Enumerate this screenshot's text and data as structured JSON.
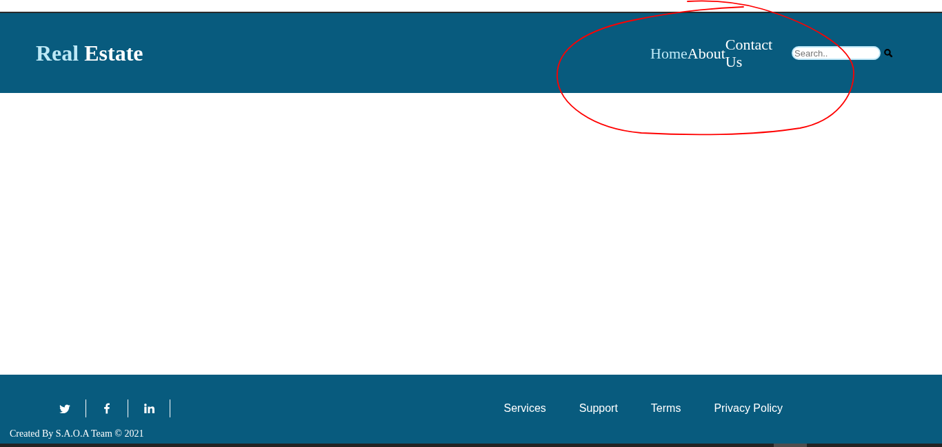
{
  "header": {
    "logo": {
      "words": [
        {
          "text": "Real",
          "accent": true
        },
        {
          "text": "Estate",
          "accent": false
        }
      ]
    },
    "nav": [
      {
        "label": "Home",
        "selected": true
      },
      {
        "label": "About",
        "selected": false
      },
      {
        "label": "Contact Us",
        "selected": false
      }
    ],
    "search": {
      "placeholder": "Search.."
    }
  },
  "footer": {
    "social": [
      {
        "kind": "bird"
      },
      {
        "kind": "f"
      },
      {
        "kind": "in"
      }
    ],
    "links": [
      "Services",
      "Support",
      "Terms",
      "Privacy Policy"
    ],
    "credit": "Created By S.A.O.A Team © 2021"
  },
  "annotation": {
    "kind": "ellipse"
  }
}
